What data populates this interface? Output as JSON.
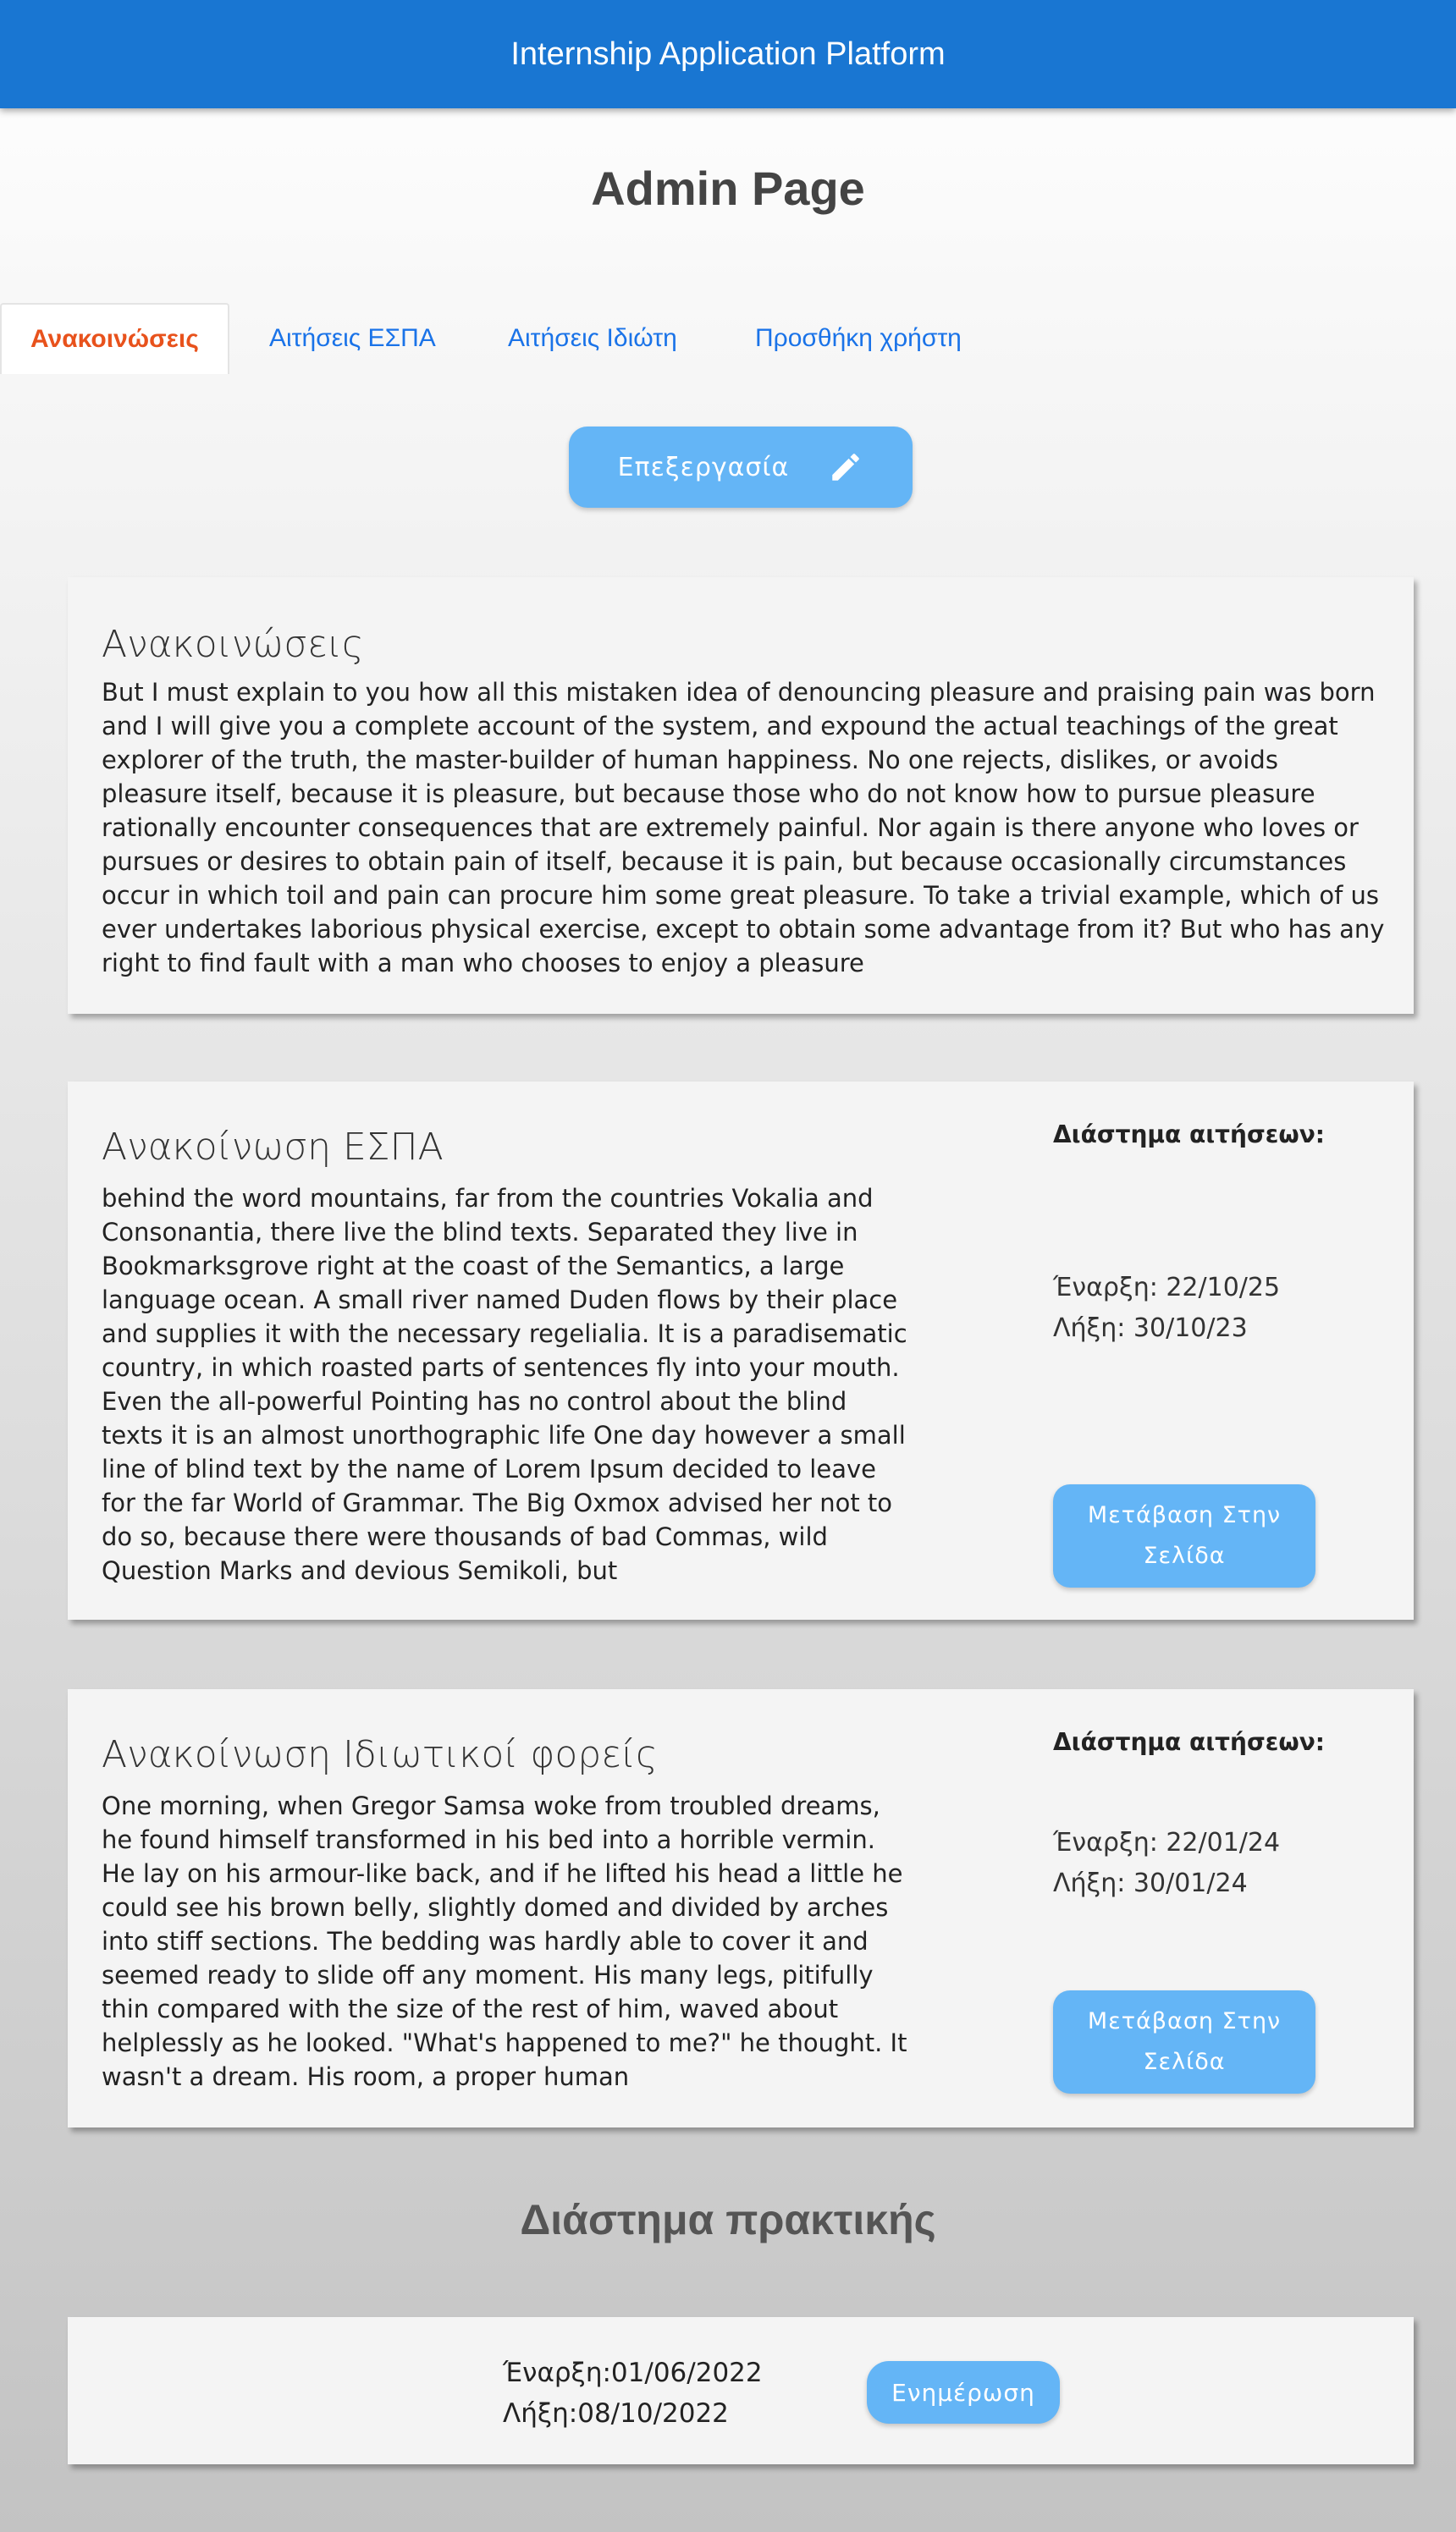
{
  "app": {
    "title": "Internship Application Platform"
  },
  "page": {
    "title": "Admin Page"
  },
  "tabs": [
    {
      "label": "Ανακοινώσεις",
      "active": true
    },
    {
      "label": "Αιτήσεις ΕΣΠΑ",
      "active": false
    },
    {
      "label": "Αιτήσεις Ιδιώτη",
      "active": false
    },
    {
      "label": "Προσθήκη χρήστη",
      "active": false
    }
  ],
  "edit_button": {
    "label": "Επεξεργασία",
    "icon": "pencil-icon"
  },
  "announcements": {
    "title": "Ανακοινώσεις",
    "text": "But I must explain to you how all this mistaken idea of denouncing pleasure and praising pain was born and I will give you a complete account of the system, and expound the actual teachings of the great explorer of the truth, the master-builder of human happiness. No one rejects, dislikes, or avoids pleasure itself, because it is pleasure, but because those who do not know how to pursue pleasure rationally encounter consequences that are extremely painful. Nor again is there anyone who loves or pursues or desires to obtain pain of itself, because it is pain, but because occasionally circumstances occur in which toil and pain can procure him some great pleasure. To take a trivial example, which of us ever undertakes laborious physical exercise, except to obtain some advantage from it? But who has any right to find fault with a man who chooses to enjoy a pleasure"
  },
  "espa": {
    "title": "Ανακοίνωση ΕΣΠΑ",
    "text": "behind the word mountains, far from the countries Vokalia and Consonantia, there live the blind texts. Separated they live in Bookmarksgrove right at the coast of the Semantics, a large language ocean. A small river named Duden flows by their place and supplies it with the necessary regelialia. It is a paradisematic country, in which roasted parts of sentences fly into your mouth. Even the all-powerful Pointing has no control about the blind texts it is an almost unorthographic life One day however a small line of blind text by the name of Lorem Ipsum decided to leave for the far World of Grammar. The Big Oxmox advised her not to do so, because there were thousands of bad Commas, wild Question Marks and devious Semikoli, but",
    "period_label": "Διάστημα αιτήσεων:",
    "start": "Έναρξη: 22/10/25",
    "end": "Λήξη: 30/10/23",
    "button_label": "Μετάβαση Στην Σελίδα"
  },
  "private": {
    "title": "Ανακοίνωση Ιδιωτικοί φορείς",
    "text": "One morning, when Gregor Samsa woke from troubled dreams, he found himself transformed in his bed into a horrible vermin. He lay on his armour-like back, and if he lifted his head a little he could see his brown belly, slightly domed and divided by arches into stiff sections. The bedding was hardly able to cover it and seemed ready to slide off any moment. His many legs, pitifully thin compared with the size of the rest of him, waved about helplessly as he looked. \"What's happened to me?\" he thought. It wasn't a dream. His room, a proper human",
    "period_label": "Διάστημα αιτήσεων:",
    "start": "Έναρξη: 22/01/24",
    "end": "Λήξη: 30/01/24",
    "button_label": "Μετάβαση Στην Σελίδα"
  },
  "internship_period": {
    "title": "Διάστημα πρακτικής",
    "start": "Έναρξη:01/06/2022",
    "end": "Λήξη:08/10/2022",
    "button_label": "Ενημέρωση"
  },
  "colors": {
    "header": "#1976d2",
    "button": "#64b5f6",
    "active_tab": "#e8521c",
    "tab_link": "#1a73e8"
  }
}
